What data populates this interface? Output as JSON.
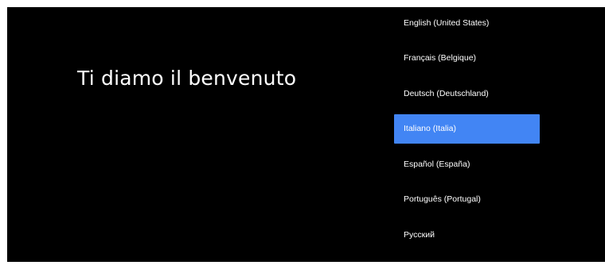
{
  "welcome": {
    "title": "Ti diamo il benvenuto"
  },
  "language_list": {
    "selected_index": 3,
    "accent_color": "#4285f4",
    "background_color": "#000000",
    "items": [
      {
        "label": "English (United States)"
      },
      {
        "label": "Français (Belgique)"
      },
      {
        "label": "Deutsch (Deutschland)"
      },
      {
        "label": "Italiano (Italia)"
      },
      {
        "label": "Español (España)"
      },
      {
        "label": "Português (Portugal)"
      },
      {
        "label": "Русский"
      }
    ]
  }
}
